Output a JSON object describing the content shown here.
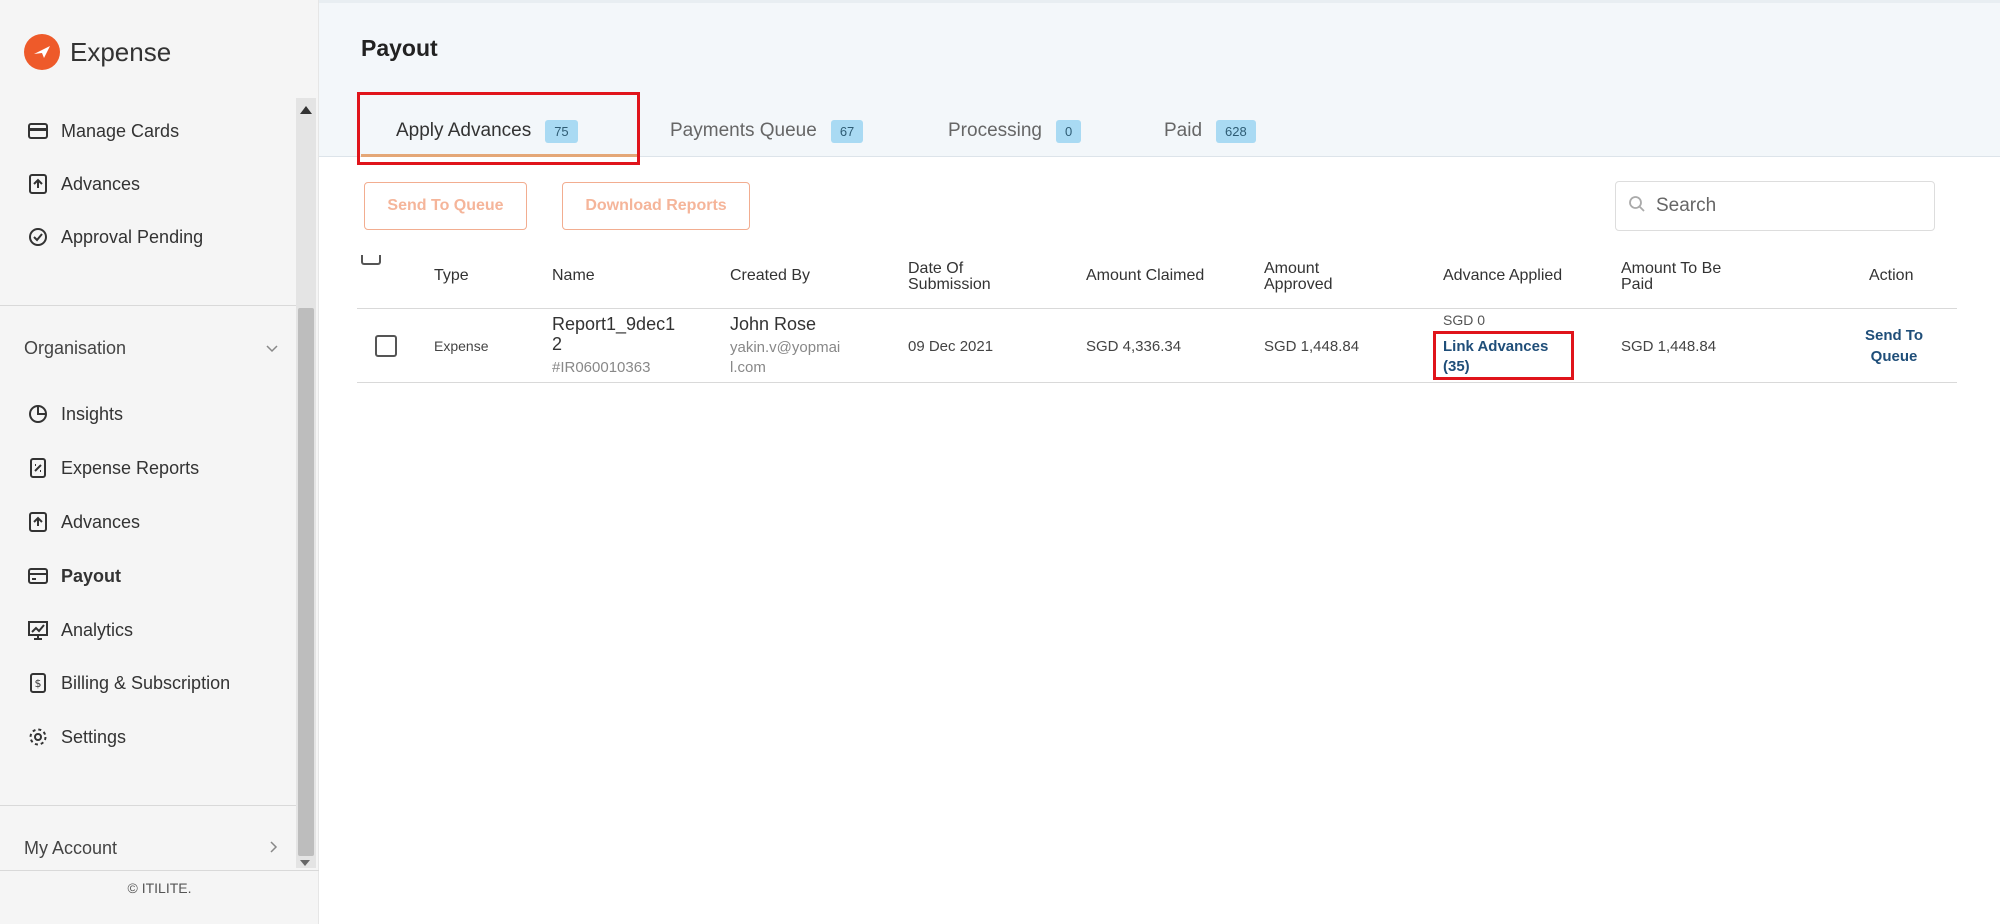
{
  "app": {
    "name": "Expense"
  },
  "sidebar": {
    "top_items": [
      {
        "label": "Manage Cards",
        "icon": "card-icon"
      },
      {
        "label": "Advances",
        "icon": "advances-icon"
      },
      {
        "label": "Approval Pending",
        "icon": "check-circle-icon"
      }
    ],
    "organisation_label": "Organisation",
    "org_items": [
      {
        "label": "Insights",
        "icon": "pie-chart-icon"
      },
      {
        "label": "Expense Reports",
        "icon": "report-icon"
      },
      {
        "label": "Advances",
        "icon": "advances-icon"
      },
      {
        "label": "Payout",
        "icon": "payout-icon"
      },
      {
        "label": "Analytics",
        "icon": "analytics-icon"
      },
      {
        "label": "Billing & Subscription",
        "icon": "billing-icon"
      },
      {
        "label": "Settings",
        "icon": "gear-icon"
      }
    ],
    "my_account_label": "My Account",
    "footer": "© ITILITE."
  },
  "header": {
    "title": "Payout",
    "tabs": [
      {
        "label": "Apply Advances",
        "count": "75"
      },
      {
        "label": "Payments Queue",
        "count": "67"
      },
      {
        "label": "Processing",
        "count": "0"
      },
      {
        "label": "Paid",
        "count": "628"
      }
    ]
  },
  "toolbar": {
    "send_to_queue": "Send To Queue",
    "download_reports": "Download Reports",
    "search_placeholder": "Search"
  },
  "table": {
    "headers": {
      "type": "Type",
      "name": "Name",
      "created_by": "Created By",
      "date_line1": "Date Of",
      "date_line2": "Submission",
      "amount_claimed": "Amount Claimed",
      "amount_approved_line1": "Amount",
      "amount_approved_line2": "Approved",
      "advance_applied": "Advance Applied",
      "to_be_paid_line1": "Amount To Be",
      "to_be_paid_line2": "Paid",
      "action": "Action"
    },
    "rows": [
      {
        "type": "Expense",
        "name_line1": "Report1_9dec1",
        "name_line2": "2",
        "report_id": "#IR060010363",
        "created_by": "John Rose",
        "email_line1": "yakin.v@yopmai",
        "email_line2": "l.com",
        "date": "09 Dec 2021",
        "amount_claimed": "SGD 4,336.34",
        "amount_approved": "SGD 1,448.84",
        "advance_applied": "SGD 0",
        "link_line1": "Link Advances",
        "link_line2": "(35)",
        "to_be_paid": "SGD 1,448.84",
        "action_line1": "Send To",
        "action_line2": "Queue"
      }
    ]
  },
  "colors": {
    "accent": "#ee5a2a",
    "badge": "#a9daf3",
    "highlight": "#e0141b",
    "link": "#1f4e79"
  }
}
